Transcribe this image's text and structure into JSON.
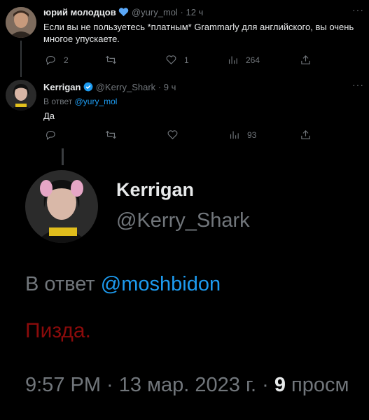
{
  "tweet1": {
    "name": "юрий молодцов",
    "handle": "@yury_mol",
    "time": "· 12 ч",
    "text_line1": "Если вы не пользуетесь *платным* Grammarly для английского, вы очень",
    "text_line2": "многое упускаете.",
    "replies": "2",
    "retweets": "",
    "likes": "1",
    "views": "264"
  },
  "tweet2": {
    "name": "Kerrigan",
    "handle": "@Kerry_Shark",
    "time": "· 9 ч",
    "reply_prefix": "В ответ",
    "reply_to": "@yury_mol",
    "text": "Да",
    "views": "93"
  },
  "zoomed": {
    "name": "Kerrigan",
    "handle": "@Kerry_Shark",
    "reply_prefix": "В ответ",
    "reply_to": "@moshbidon",
    "text": "Пизда.",
    "time": "9:57 PM · 13 мар. 2023 г. ·",
    "views_count": "9",
    "views_label": "просм"
  },
  "colors": {
    "background": "#000000",
    "accent": "#1d9bf0",
    "muted": "#71767b",
    "red_text": "#8b0b0b"
  },
  "icons": [
    "verified-blue-heart-icon",
    "verified-badge-icon",
    "more-icon",
    "reply-icon",
    "retweet-icon",
    "like-icon",
    "views-icon",
    "share-icon"
  ]
}
